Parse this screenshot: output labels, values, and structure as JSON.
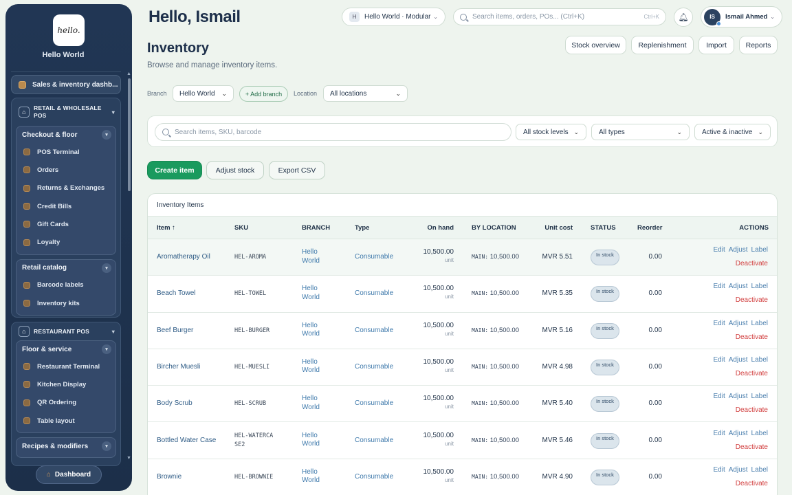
{
  "sidebar": {
    "org_name": "Hello World",
    "logo_text": "hello.",
    "top_link": "Sales & inventory dashb...",
    "groups": [
      {
        "title": "RETAIL & WHOLESALE POS",
        "subs": [
          {
            "title": "Checkout & floor",
            "items": [
              "POS Terminal",
              "Orders",
              "Returns & Exchanges",
              "Credit Bills",
              "Gift Cards",
              "Loyalty"
            ]
          },
          {
            "title": "Retail catalog",
            "items": [
              "Barcode labels",
              "Inventory kits"
            ]
          }
        ]
      },
      {
        "title": "RESTAURANT POS",
        "subs": [
          {
            "title": "Floor & service",
            "items": [
              "Restaurant Terminal",
              "Kitchen Display",
              "QR Ordering",
              "Table layout"
            ]
          },
          {
            "title": "Recipes & modifiers",
            "items": []
          }
        ]
      }
    ],
    "dashboard_label": "Dashboard"
  },
  "header": {
    "greeting": "Hello, Ismail",
    "org_badge": "H",
    "org_selector": "Hello World · Modular",
    "search_placeholder": "Search items, orders, POs... (Ctrl+K)",
    "search_shortcut": "Ctrl+K",
    "user_initials": "IS",
    "user_name": "Ismail Ahmed"
  },
  "page": {
    "title": "Inventory",
    "subtitle": "Browse and manage inventory items.",
    "top_buttons": [
      "Stock overview",
      "Replenishment",
      "Import",
      "Reports"
    ]
  },
  "filters": {
    "branch_label": "Branch",
    "branch_value": "Hello World",
    "add_branch": "+ Add branch",
    "location_label": "Location",
    "location_value": "All locations",
    "search_placeholder": "Search items, SKU, barcode",
    "stock_level": "All stock levels",
    "type": "All types",
    "active": "Active & inactive"
  },
  "actions": [
    "Create item",
    "Adjust stock",
    "Export CSV"
  ],
  "table": {
    "title": "Inventory Items",
    "headers": [
      "Item ↑",
      "SKU",
      "BRANCH",
      "Type",
      "On hand",
      "BY LOCATION",
      "Unit cost",
      "STATUS",
      "Reorder",
      "ACTIONS"
    ],
    "row_actions": [
      "Edit",
      "Adjust",
      "Label",
      "Deactivate"
    ],
    "rows": [
      {
        "name": "Aromatherapy Oil",
        "sku": "HEL-AROMA",
        "branch": "Hello World",
        "type": "Consumable",
        "on_hand": "10,500.00",
        "unit": "unit",
        "loc_key": "MAIN:",
        "loc_val": "10,500.00",
        "cost": "MVR 5.51",
        "status": "In stock",
        "reorder": "0.00"
      },
      {
        "name": "Beach Towel",
        "sku": "HEL-TOWEL",
        "branch": "Hello World",
        "type": "Consumable",
        "on_hand": "10,500.00",
        "unit": "unit",
        "loc_key": "MAIN:",
        "loc_val": "10,500.00",
        "cost": "MVR 5.35",
        "status": "In stock",
        "reorder": "0.00"
      },
      {
        "name": "Beef Burger",
        "sku": "HEL-BURGER",
        "branch": "Hello World",
        "type": "Consumable",
        "on_hand": "10,500.00",
        "unit": "unit",
        "loc_key": "MAIN:",
        "loc_val": "10,500.00",
        "cost": "MVR 5.16",
        "status": "In stock",
        "reorder": "0.00"
      },
      {
        "name": "Bircher Muesli",
        "sku": "HEL-MUESLI",
        "branch": "Hello World",
        "type": "Consumable",
        "on_hand": "10,500.00",
        "unit": "unit",
        "loc_key": "MAIN:",
        "loc_val": "10,500.00",
        "cost": "MVR 4.98",
        "status": "In stock",
        "reorder": "0.00"
      },
      {
        "name": "Body Scrub",
        "sku": "HEL-SCRUB",
        "branch": "Hello World",
        "type": "Consumable",
        "on_hand": "10,500.00",
        "unit": "unit",
        "loc_key": "MAIN:",
        "loc_val": "10,500.00",
        "cost": "MVR 5.40",
        "status": "In stock",
        "reorder": "0.00"
      },
      {
        "name": "Bottled Water Case",
        "sku": "HEL-WATERCASE2",
        "branch": "Hello World",
        "type": "Consumable",
        "on_hand": "10,500.00",
        "unit": "unit",
        "loc_key": "MAIN:",
        "loc_val": "10,500.00",
        "cost": "MVR 5.46",
        "status": "In stock",
        "reorder": "0.00"
      },
      {
        "name": "Brownie",
        "sku": "HEL-BROWNIE",
        "branch": "Hello World",
        "type": "Consumable",
        "on_hand": "10,500.00",
        "unit": "unit",
        "loc_key": "MAIN:",
        "loc_val": "10,500.00",
        "cost": "MVR 4.90",
        "status": "In stock",
        "reorder": "0.00"
      }
    ]
  },
  "colors": {
    "primary": "#1a9a5e",
    "sidebar": "#213654",
    "danger": "#d13d3d",
    "link": "#3e79ab"
  }
}
